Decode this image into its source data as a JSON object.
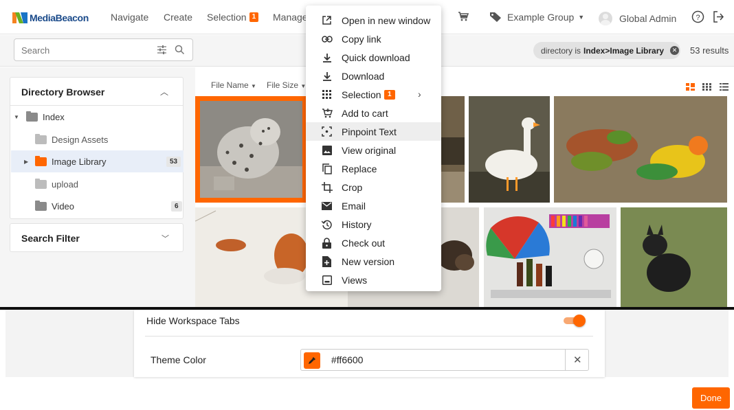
{
  "brand": {
    "logo_text": "MediaBeacon"
  },
  "nav": {
    "navigate": "Navigate",
    "create": "Create",
    "selection": "Selection",
    "selection_count": "1",
    "manage": "Manage",
    "group": "Example Group",
    "user": "Global Admin"
  },
  "search": {
    "placeholder": "Search"
  },
  "filter": {
    "prefix": "directory is ",
    "value": "Index>Image Library",
    "results": "53 results"
  },
  "directory": {
    "title": "Directory Browser",
    "items": [
      {
        "label": "Index"
      },
      {
        "label": "Design Assets"
      },
      {
        "label": "Image Library",
        "count": "53"
      },
      {
        "label": "upload"
      },
      {
        "label": "Video",
        "count": "6"
      }
    ]
  },
  "search_filter": {
    "title": "Search Filter"
  },
  "sort": {
    "file_name": "File Name",
    "file_size": "File Size"
  },
  "context_menu": {
    "items": [
      {
        "label": "Open in new window",
        "icon": "open-external-icon"
      },
      {
        "label": "Copy link",
        "icon": "link-icon"
      },
      {
        "label": "Quick download",
        "icon": "quick-download-icon"
      },
      {
        "label": "Download",
        "icon": "download-icon"
      },
      {
        "label": "Selection",
        "icon": "grid-icon",
        "badge": "1"
      },
      {
        "label": "Add to cart",
        "icon": "cart-add-icon"
      },
      {
        "label": "Pinpoint Text",
        "icon": "pinpoint-icon"
      },
      {
        "label": "View original",
        "icon": "image-icon"
      },
      {
        "label": "Replace",
        "icon": "replace-icon"
      },
      {
        "label": "Crop",
        "icon": "crop-icon"
      },
      {
        "label": "Email",
        "icon": "email-icon"
      },
      {
        "label": "History",
        "icon": "history-icon"
      },
      {
        "label": "Check out",
        "icon": "lock-icon"
      },
      {
        "label": "New version",
        "icon": "new-version-icon"
      },
      {
        "label": "Views",
        "icon": "views-icon"
      }
    ]
  },
  "settings": {
    "hide_tabs_label": "Hide Workspace Tabs",
    "hide_tabs_on": true,
    "theme_color_label": "Theme Color",
    "theme_color_value": "#ff6600"
  },
  "footer": {
    "done_label": "Done"
  },
  "colors": {
    "accent": "#ff6600",
    "brand": "#1a4a8a",
    "highlight_row": "#e8eef8"
  }
}
